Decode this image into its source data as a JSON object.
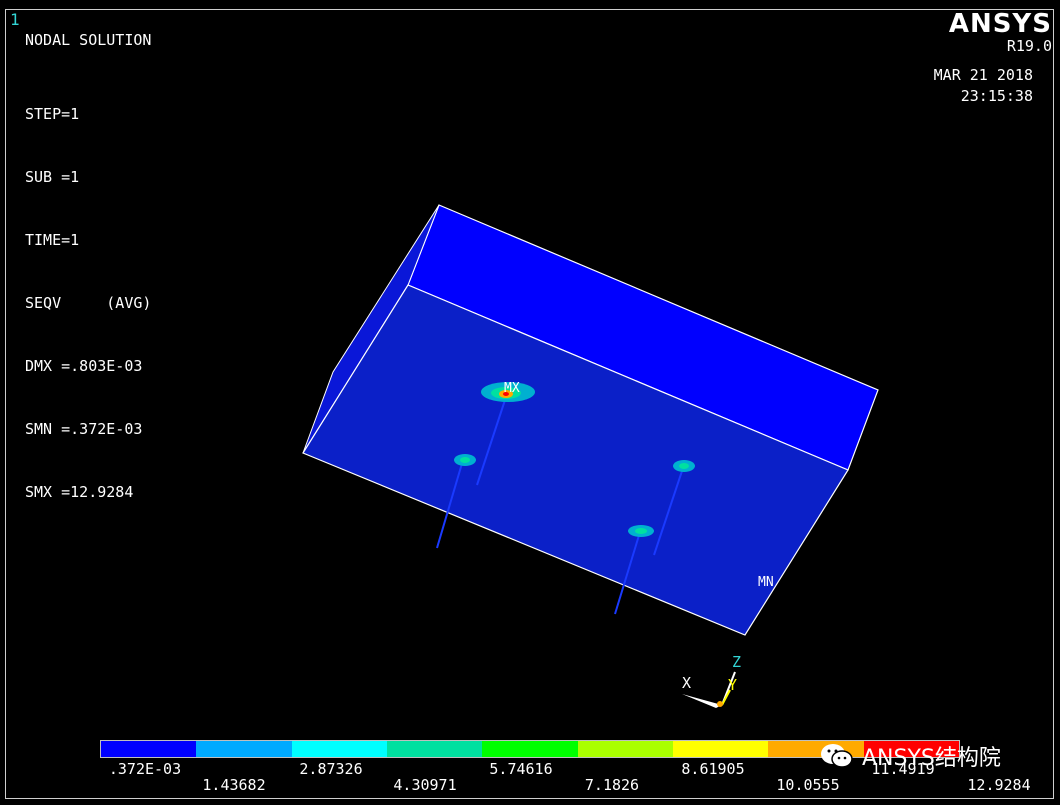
{
  "window": {
    "number": "1"
  },
  "header": {
    "title": "NODAL SOLUTION",
    "stats": [
      "STEP=1",
      "SUB =1",
      "TIME=1",
      "SEQV     (AVG)",
      "DMX =.803E-03",
      "SMN =.372E-03",
      "SMX =12.9284"
    ]
  },
  "brand": {
    "name": "ANSYS",
    "release": "R19.0"
  },
  "timestamp": {
    "date": "MAR 21 2018",
    "time": "23:15:38"
  },
  "labels": {
    "max": "MX",
    "min": "MN"
  },
  "triad": {
    "x": "X",
    "y": "Y",
    "z": "Z"
  },
  "legend": {
    "colors": [
      "#0000ff",
      "#00aaff",
      "#00ffff",
      "#00e0a0",
      "#00ff00",
      "#aaff00",
      "#ffff00",
      "#ffaa00",
      "#ff0000"
    ],
    "upper_ticks": [
      ".372E-03",
      "2.87326",
      "5.74616",
      "8.61905",
      "11.4919"
    ],
    "lower_ticks": [
      "1.43682",
      "4.30971",
      "7.1826",
      "10.0555",
      "12.9284"
    ]
  },
  "watermark": {
    "text": "ANSYS结构院",
    "icon": "wechat-icon"
  },
  "colors": {
    "model_face": "#0000ff",
    "model_side": "#0a17d8",
    "edge": "#ffffff",
    "axis_label": "#33d6d6"
  }
}
